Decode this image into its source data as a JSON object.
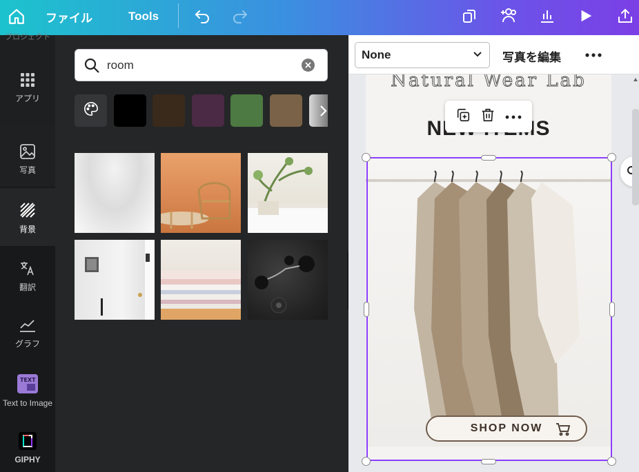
{
  "topbar": {
    "file_label": "ファイル",
    "tools_label": "Tools"
  },
  "rail": {
    "clipped_top_label": "プロジェクト",
    "items": [
      {
        "label": "アプリ",
        "icon": "apps-grid-icon"
      },
      {
        "label": "写真",
        "icon": "photo-icon"
      },
      {
        "label": "背景",
        "icon": "background-pattern-icon"
      },
      {
        "label": "翻訳",
        "icon": "translate-icon"
      },
      {
        "label": "グラフ",
        "icon": "chart-icon"
      },
      {
        "label": "Text to Image",
        "icon": "text-to-image-icon"
      },
      {
        "label": "GIPHY",
        "icon": "giphy-icon"
      }
    ]
  },
  "panel": {
    "search_value": "room",
    "swatches": [
      "#000000",
      "#3a2a1c",
      "#4a2a45",
      "#4d7a42",
      "#7a6248"
    ]
  },
  "context_bar": {
    "filter_value": "None",
    "edit_photo_label": "写真を編集"
  },
  "design": {
    "brand_text": "Natural Wear Lab",
    "heading": "NEW ITEMS",
    "cta_label": "SHOP NOW"
  }
}
